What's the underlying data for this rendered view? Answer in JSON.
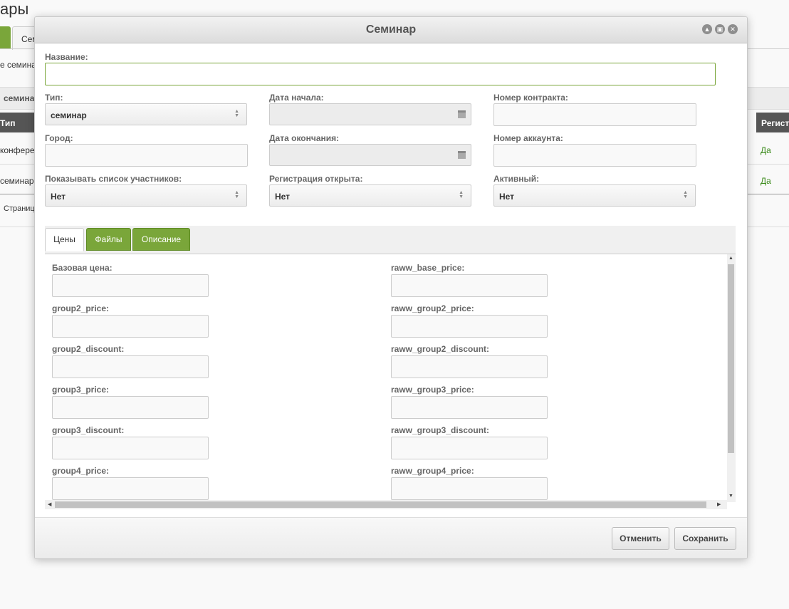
{
  "background": {
    "title": "ары",
    "tab_green_label": "",
    "tab_label": "Сем",
    "subtext": "е семина",
    "filter_label": "семина",
    "table": {
      "col_type": "Тип",
      "col_reg": "Регист",
      "rows": [
        {
          "type": "конфере",
          "reg": "Да"
        },
        {
          "type": "семинар",
          "reg": "Да"
        }
      ]
    },
    "pager": "Страниц"
  },
  "modal": {
    "title": "Семинар",
    "window_buttons": [
      "minimize-icon",
      "maximize-icon",
      "close-icon"
    ],
    "fields": {
      "name": {
        "label": "Название:",
        "value": ""
      },
      "type": {
        "label": "Тип:",
        "value": "семинар"
      },
      "start_date": {
        "label": "Дата начала:",
        "value": ""
      },
      "contract_number": {
        "label": "Номер контракта:",
        "value": ""
      },
      "city": {
        "label": "Город:",
        "value": ""
      },
      "end_date": {
        "label": "Дата окончания:",
        "value": ""
      },
      "account_number": {
        "label": "Номер аккаунта:",
        "value": ""
      },
      "show_participants": {
        "label": "Показывать список участников:",
        "value": "Нет"
      },
      "registration_open": {
        "label": "Регистрация открыта:",
        "value": "Нет"
      },
      "active": {
        "label": "Активный:",
        "value": "Нет"
      }
    },
    "tabs": [
      {
        "label": "Цены",
        "active": true
      },
      {
        "label": "Файлы",
        "active": false
      },
      {
        "label": "Описание",
        "active": false
      }
    ],
    "prices": {
      "left": [
        {
          "label": "Базовая цена:",
          "value": ""
        },
        {
          "label": "group2_price:",
          "value": ""
        },
        {
          "label": "group2_discount:",
          "value": ""
        },
        {
          "label": "group3_price:",
          "value": ""
        },
        {
          "label": "group3_discount:",
          "value": ""
        },
        {
          "label": "group4_price:",
          "value": ""
        }
      ],
      "right": [
        {
          "label": "raww_base_price:",
          "value": ""
        },
        {
          "label": "raww_group2_price:",
          "value": ""
        },
        {
          "label": "raww_group2_discount:",
          "value": ""
        },
        {
          "label": "raww_group3_price:",
          "value": ""
        },
        {
          "label": "raww_group3_discount:",
          "value": ""
        },
        {
          "label": "raww_group4_price:",
          "value": ""
        }
      ]
    },
    "footer": {
      "cancel_label": "Отменить",
      "save_label": "Сохранить"
    },
    "colors": {
      "accent": "#7aa63a",
      "focus_border": "#7aa63a",
      "table_header": "#555555"
    }
  }
}
